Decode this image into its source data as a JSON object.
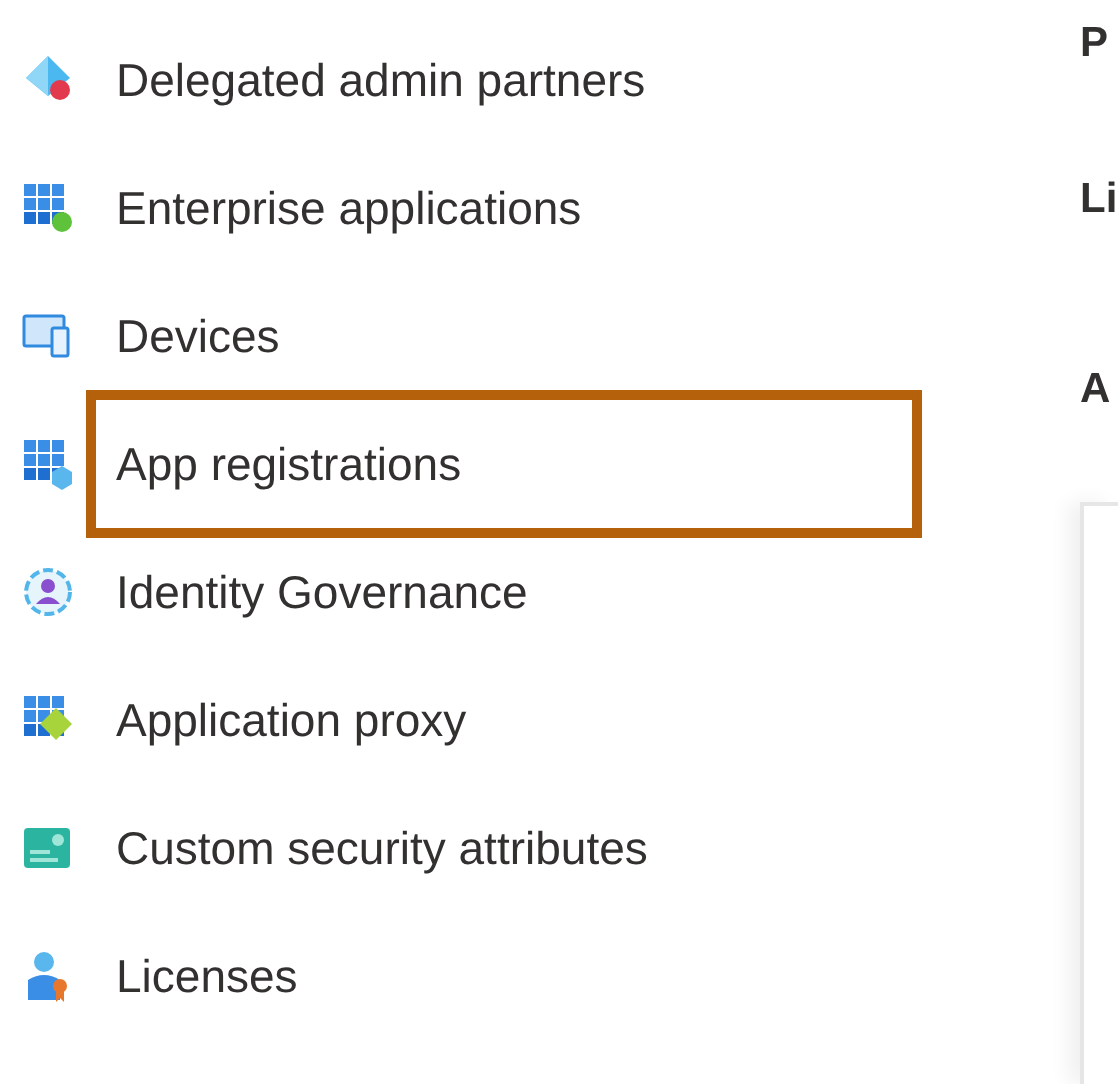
{
  "sidebar": {
    "items": [
      {
        "label": "Delegated admin partners",
        "kind": "diamond",
        "highlighted": false
      },
      {
        "label": "Enterprise applications",
        "kind": "grid-leaf",
        "highlighted": false
      },
      {
        "label": "Devices",
        "kind": "devices",
        "highlighted": false
      },
      {
        "label": "App registrations",
        "kind": "grid-cube",
        "highlighted": true
      },
      {
        "label": "Identity Governance",
        "kind": "person-ring",
        "highlighted": false
      },
      {
        "label": "Application proxy",
        "kind": "grid-gear",
        "highlighted": false
      },
      {
        "label": "Custom security attributes",
        "kind": "card",
        "highlighted": false
      },
      {
        "label": "Licenses",
        "kind": "person-badge",
        "highlighted": false
      }
    ]
  },
  "content": {
    "headings": [
      "P",
      "Li",
      "A"
    ]
  }
}
